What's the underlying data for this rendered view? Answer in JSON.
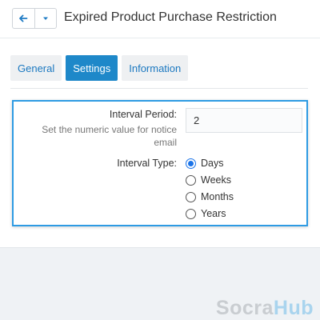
{
  "header": {
    "title": "Expired Product Purchase Restriction",
    "back_icon": "arrow-left-icon",
    "menu_icon": "caret-down-icon"
  },
  "tabs": [
    {
      "label": "General",
      "active": false
    },
    {
      "label": "Settings",
      "active": true
    },
    {
      "label": "Information",
      "active": false
    }
  ],
  "form": {
    "interval_period": {
      "label": "Interval Period:",
      "help": "Set the numeric value for notice email",
      "value": "2"
    },
    "interval_type": {
      "label": "Interval Type:",
      "options": [
        {
          "label": "Days",
          "checked": true
        },
        {
          "label": "Weeks",
          "checked": false
        },
        {
          "label": "Months",
          "checked": false
        },
        {
          "label": "Years",
          "checked": false
        }
      ]
    }
  },
  "watermark": {
    "part1": "Socra",
    "part2": "Hub"
  },
  "colors": {
    "accent": "#1e88c9",
    "panel_border": "#2e9be3",
    "link": "#1b78c0",
    "radio_checked": "#1a73e8"
  }
}
